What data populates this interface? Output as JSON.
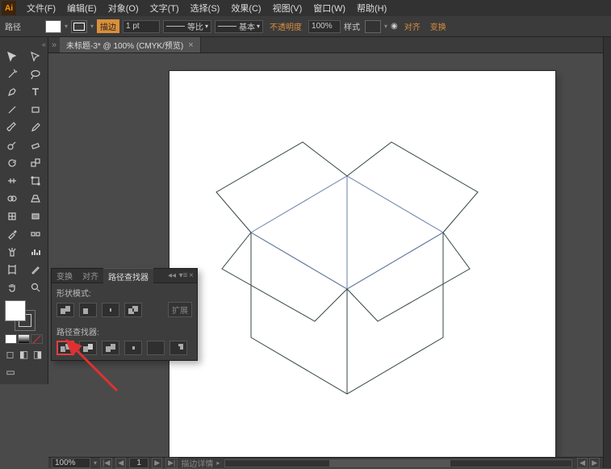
{
  "app": {
    "logo": "Ai"
  },
  "menu": {
    "file": "文件(F)",
    "edit": "编辑(E)",
    "object": "对象(O)",
    "type": "文字(T)",
    "select": "选择(S)",
    "effect": "效果(C)",
    "view": "视图(V)",
    "window": "窗口(W)",
    "help": "帮助(H)"
  },
  "controlbar": {
    "selection_label": "路径",
    "stroke_label": "描边",
    "stroke_weight": "1 pt",
    "profile_label": "等比",
    "brush_label": "基本",
    "opacity_label": "不透明度",
    "opacity_value": "100%",
    "style_label": "样式",
    "align_label": "对齐",
    "transform_label": "变换"
  },
  "document": {
    "tab_title": "未标题-3* @ 100% (CMYK/预览)",
    "tab_close": "×",
    "arrow_glyph": "»"
  },
  "statusbar": {
    "zoom": "100%",
    "label": "描边详情",
    "tri_left": "◀",
    "tri_right": "▶"
  },
  "pathfinder": {
    "tab_transform": "变换",
    "tab_align": "对齐",
    "tab_pathfinder": "路径查找器",
    "section_shape": "形状模式:",
    "section_pf": "路径查找器:",
    "expand": "扩展",
    "menu_glyph": "▾≡",
    "close_glyph": "×",
    "collapse_glyph": "◂◂"
  },
  "icons": {
    "collapse": "«"
  }
}
